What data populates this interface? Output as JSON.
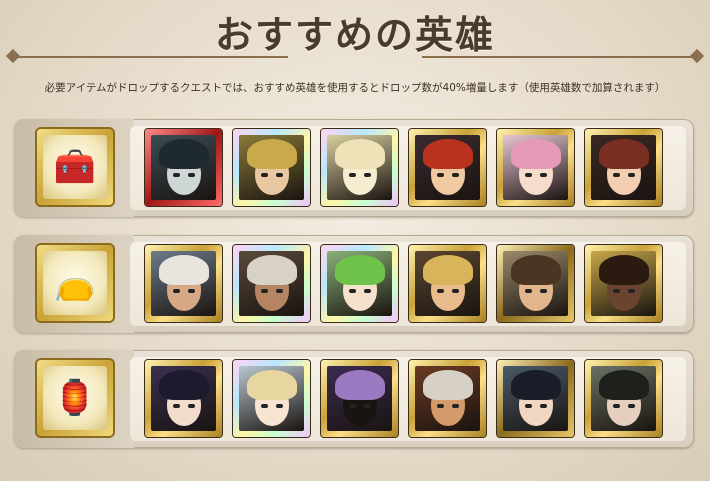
{
  "title": "おすすめの英雄",
  "subtitle": "必要アイテムがドロップするクエストでは、おすすめ英雄を使用するとドロップ数が40%増量します（使用英雄数で加算されます）",
  "rows": [
    {
      "item_icon": "treasure-box-icon",
      "heroes": [
        {
          "name": "hero-1",
          "frame": "red",
          "bg": "#3c4c55",
          "hair": "#1e2a30",
          "skin": "#cfd6d6"
        },
        {
          "name": "hero-2",
          "frame": "rainbow",
          "bg": "#8a7a3a",
          "hair": "#c9a94a",
          "skin": "#e8c8a0"
        },
        {
          "name": "hero-3",
          "frame": "rainbow",
          "bg": "#d8cfa0",
          "hair": "#efe2b8",
          "skin": "#f6ecd0"
        },
        {
          "name": "hero-4",
          "frame": "gold",
          "bg": "#3a2a30",
          "hair": "#b8321e",
          "skin": "#f0c9a0"
        },
        {
          "name": "hero-5",
          "frame": "gold",
          "bg": "#e7c6d3",
          "hair": "#e59ab8",
          "skin": "#f8dccb"
        },
        {
          "name": "hero-6",
          "frame": "gold",
          "bg": "#3a2824",
          "hair": "#7a2f22",
          "skin": "#f2cdb0"
        }
      ]
    },
    {
      "item_icon": "pouch-icon",
      "heroes": [
        {
          "name": "hero-7",
          "frame": "gold",
          "bg": "#6e7a8a",
          "hair": "#e8e4de",
          "skin": "#d7a886"
        },
        {
          "name": "hero-8",
          "frame": "rainbow",
          "bg": "#5a4a3a",
          "hair": "#d8d2c6",
          "skin": "#b58463"
        },
        {
          "name": "hero-9",
          "frame": "rainbow",
          "bg": "#8ab07a",
          "hair": "#6fc24a",
          "skin": "#f5e1cc"
        },
        {
          "name": "hero-10",
          "frame": "gold",
          "bg": "#5a4630",
          "hair": "#d8b45a",
          "skin": "#e8bc8c"
        },
        {
          "name": "hero-11",
          "frame": "dark",
          "bg": "#9a8a6a",
          "hair": "#4a3422",
          "skin": "#e3b58c"
        },
        {
          "name": "hero-12",
          "frame": "gold",
          "bg": "#c6a64a",
          "hair": "#2a1a10",
          "skin": "#6a4430"
        }
      ]
    },
    {
      "item_icon": "charm-bag-icon",
      "heroes": [
        {
          "name": "hero-13",
          "frame": "gold",
          "bg": "#3a3050",
          "hair": "#1e1a2e",
          "skin": "#f4dccc"
        },
        {
          "name": "hero-14",
          "frame": "rainbow",
          "bg": "#b8c6d0",
          "hair": "#e8d6a0",
          "skin": "#f8e4d2"
        },
        {
          "name": "hero-15",
          "frame": "gold",
          "bg": "#3a2a50",
          "hair": "#9a7ac0",
          "skin": "#1a1410"
        },
        {
          "name": "hero-16",
          "frame": "gold",
          "bg": "#6a3a22",
          "hair": "#d6d0c6",
          "skin": "#d49a6a"
        },
        {
          "name": "hero-17",
          "frame": "dark",
          "bg": "#4a5a6a",
          "hair": "#1a1e28",
          "skin": "#f1d6c2"
        },
        {
          "name": "hero-18",
          "frame": "gold",
          "bg": "#6a7264",
          "hair": "#1e201c",
          "skin": "#e6cfbe"
        }
      ]
    }
  ]
}
